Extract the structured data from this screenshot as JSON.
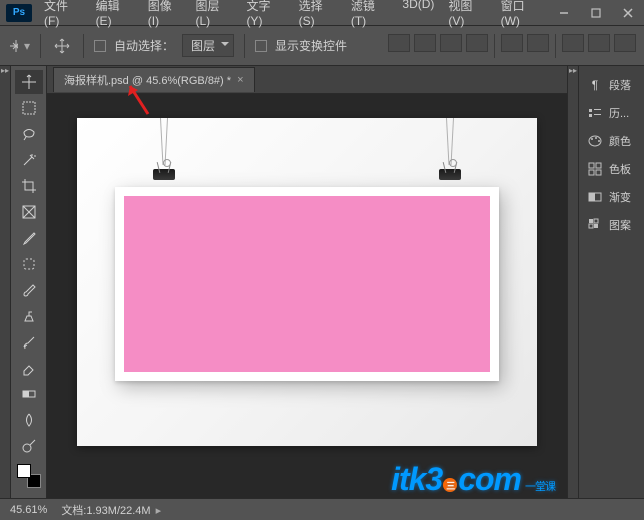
{
  "menu": {
    "items": [
      "文件(F)",
      "编辑(E)",
      "图像(I)",
      "图层(L)",
      "文字(Y)",
      "选择(S)",
      "滤镜(T)",
      "3D(D)",
      "视图(V)",
      "窗口(W)"
    ]
  },
  "options": {
    "auto_select_label": "自动选择：",
    "dropdown_value": "图层",
    "show_transform_label": "显示变换控件"
  },
  "doc_tab": {
    "title": "海报样机.psd @ 45.6%(RGB/8#) *"
  },
  "panels": {
    "items": [
      {
        "icon": "paragraph",
        "label": "段落"
      },
      {
        "icon": "history",
        "label": "历..."
      },
      {
        "icon": "color",
        "label": "颜色"
      },
      {
        "icon": "swatches",
        "label": "色板"
      },
      {
        "icon": "gradient",
        "label": "渐变"
      },
      {
        "icon": "patterns",
        "label": "图案"
      }
    ]
  },
  "status": {
    "zoom": "45.61%",
    "doc_info": "文档:1.93M/22.4M"
  },
  "watermark": {
    "main": "itk3",
    "dot": "三",
    "suffix": "com",
    "sub": "一堂课"
  }
}
